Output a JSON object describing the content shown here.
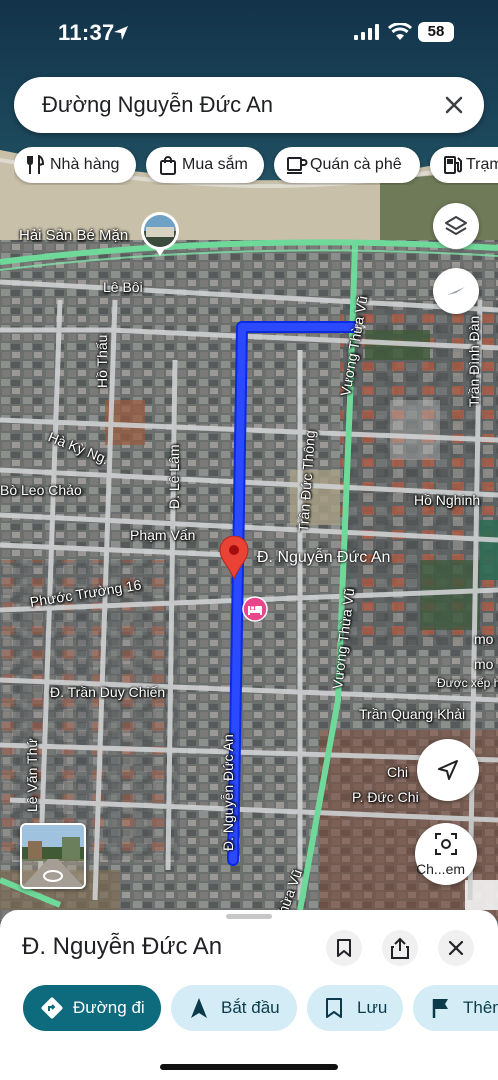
{
  "status_bar": {
    "time": "11:37",
    "battery": "58"
  },
  "search": {
    "query": "Đường Nguyễn Đức An"
  },
  "chips": [
    {
      "label": "Nhà hàng",
      "icon": "restaurant-icon"
    },
    {
      "label": "Mua sắm",
      "icon": "shopping-icon"
    },
    {
      "label": "Quán cà phê",
      "icon": "coffee-icon"
    },
    {
      "label": "Trạm",
      "icon": "gas-station-icon"
    }
  ],
  "map": {
    "poi_label": "Hải Sản Bé Mặn",
    "destination_label": "Đ. Nguyễn Đức An",
    "street_labels": [
      "Lê Bôi",
      "Hồ Thấu",
      "Vương Thừa Vũ",
      "Trần Đình Đàn",
      "Hà Kỳ Ng.",
      "Đ. Lê Lâm",
      "Trần Đức Thông",
      "Bò Leo Chảo",
      "Hồ Nghinh",
      "Phạm Vấn",
      "Phước Trường 16",
      "Vương Thừa Vũ",
      "Đ. Trần Duy Chiến",
      "Trần Quang Khải",
      "Lê Văn Thứ",
      "Đ. Nguyễn Đức An",
      "Chi",
      "P. Đức Chi",
      "hừa Vũ",
      "mo",
      "mo",
      "Được xếp h"
    ],
    "colors": {
      "route": "#1a3cff",
      "pin": "#ea4335",
      "road_green": "#6fd99a",
      "hotel_pin": "#e8458b"
    }
  },
  "street_view_button": {
    "label": "Ch...em"
  },
  "place": {
    "name": "Đ. Nguyễn Đức An"
  },
  "actions": [
    {
      "label": "Đường đi",
      "icon": "directions-icon"
    },
    {
      "label": "Bắt đầu",
      "icon": "navigation-icon"
    },
    {
      "label": "Lưu",
      "icon": "bookmark-icon"
    },
    {
      "label": "Thêm",
      "icon": "flag-icon"
    }
  ]
}
